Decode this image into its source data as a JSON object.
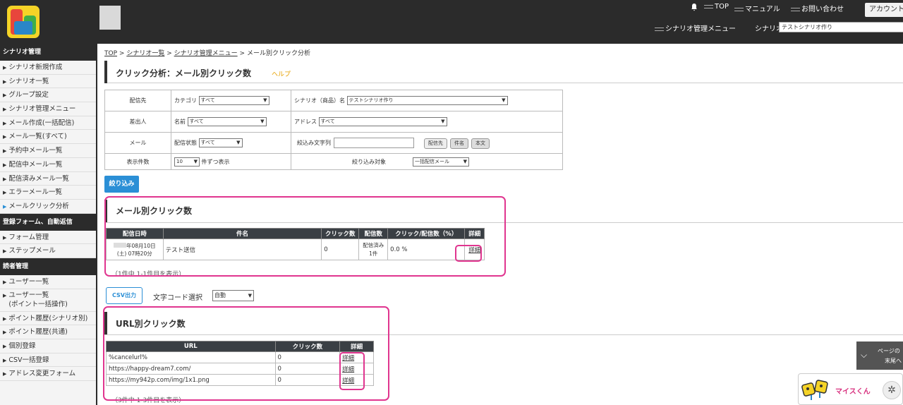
{
  "header": {
    "nav_top": "TOP",
    "nav_manual": "マニュアル",
    "nav_contact": "お問い合わせ",
    "account": "アカウント",
    "scenario_menu": "シナリオ管理メニュー",
    "scenario_label": "シナリオ",
    "scenario_select": "テストシナリオ作り"
  },
  "sidebar": {
    "sections": [
      {
        "title": "シナリオ管理",
        "items": [
          "シナリオ新規作成",
          "シナリオ一覧",
          "グループ設定",
          "シナリオ管理メニュー",
          "メール作成(一括配信)",
          "メール一覧(すべて)",
          "予約中メール一覧",
          "配信中メール一覧",
          "配信済みメール一覧",
          "エラーメール一覧",
          "メールクリック分析"
        ]
      },
      {
        "title": "登録フォーム、自動返信",
        "items": [
          "フォーム管理",
          "ステップメール"
        ]
      },
      {
        "title": "読者管理",
        "items": [
          "ユーザー一覧",
          "ユーザー一覧\n(ポイント一括操作)",
          "ポイント履歴(シナリオ別)",
          "ポイント履歴(共通)",
          "個別登録",
          "CSV一括登録",
          "アドレス変更フォーム"
        ]
      }
    ]
  },
  "breadcrumb": {
    "top": "TOP",
    "list": "シナリオ一覧",
    "menu": "シナリオ管理メニュー",
    "current": "メール別クリック分析",
    "sep": ">"
  },
  "page": {
    "title": "クリック分析：メール別クリック数",
    "help": "ヘルプ"
  },
  "filter": {
    "row1": {
      "label": "配信先",
      "category_label": "カテゴリ",
      "category_value": "すべて",
      "scenario_label": "シナリオ（商品）名",
      "scenario_value": "テストシナリオ作り"
    },
    "row2": {
      "label": "差出人",
      "name_label": "名前",
      "name_value": "すべて",
      "address_label": "アドレス",
      "address_value": "すべて"
    },
    "row3": {
      "label": "メール",
      "status_label": "配信状態",
      "status_value": "すべて",
      "search_label": "絞込み文字列",
      "btn_dest": "配信先",
      "btn_subject": "件名",
      "btn_body": "本文"
    },
    "row4": {
      "label": "表示件数",
      "count_value": "10",
      "count_suffix": "件ずつ表示",
      "target_label": "絞り込み対象",
      "target_value": "一括配信メール"
    },
    "apply": "絞り込み"
  },
  "mail_section": {
    "title": "メール別クリック数",
    "headers": [
      "配信日時",
      "件名",
      "クリック数",
      "配信数",
      "クリック/配信数（%）",
      "詳細"
    ],
    "rows": [
      {
        "date1": "年08月10日",
        "date2": "(土) 07時20分",
        "subject": "テスト送信",
        "clicks": "0",
        "sent1": "配信済み",
        "sent2": "1件",
        "rate": "0.0 %",
        "detail": "詳細"
      }
    ],
    "count_text": "（1件中 1-1件目を表示）"
  },
  "csv": {
    "button": "CSV出力",
    "charset_label": "文字コード選択",
    "charset_value": "自動"
  },
  "url_section": {
    "title": "URL別クリック数",
    "headers": [
      "URL",
      "クリック数",
      "詳細"
    ],
    "rows": [
      {
        "url": "%cancelurl%",
        "clicks": "0",
        "detail": "詳細"
      },
      {
        "url": "https://happy-dream7.com/",
        "clicks": "0",
        "detail": "詳細"
      },
      {
        "url": "https://my942p.com/img/1x1.png",
        "clicks": "0",
        "detail": "詳細"
      }
    ],
    "count_text": "（3件中 1-3件目を表示）"
  },
  "floating": {
    "page_line1": "ページの",
    "page_line2": "末尾へ",
    "chat": "マイスくん"
  },
  "colors": {
    "accent": "#2b8fd6",
    "highlight": "#e0358f",
    "dark": "#2b2b2b"
  }
}
